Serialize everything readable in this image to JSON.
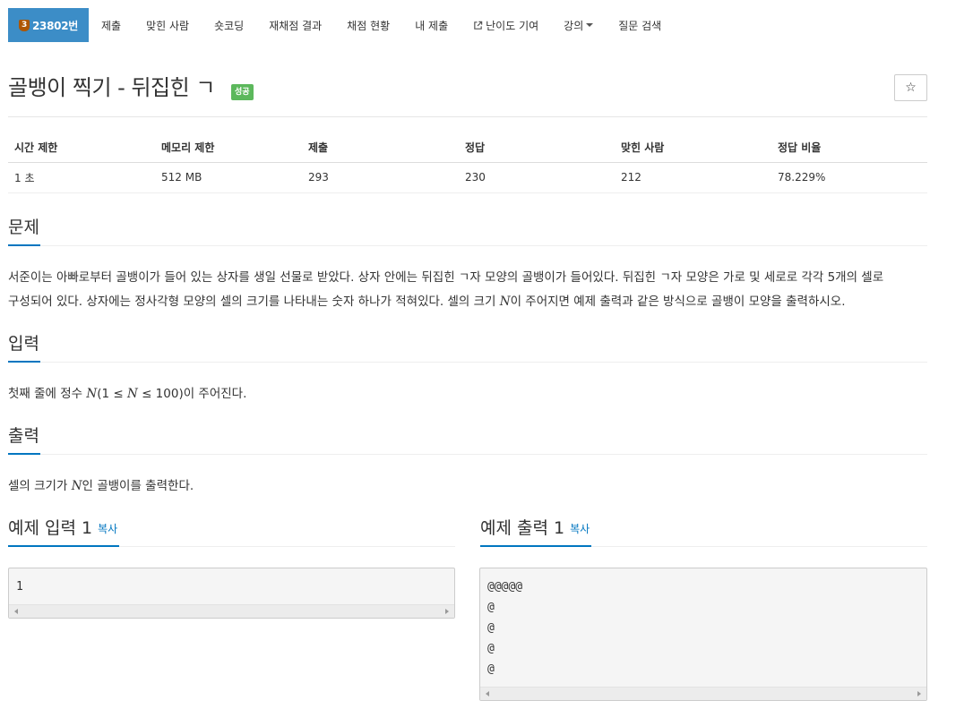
{
  "nav": {
    "problem_tier": "3",
    "problem_id": "23802번",
    "items": [
      "제출",
      "맞힌 사람",
      "숏코딩",
      "재채점 결과",
      "채점 현황",
      "내 제출",
      "난이도 기여",
      "강의",
      "질문 검색"
    ]
  },
  "problem": {
    "title": "골뱅이 찍기 - 뒤집힌 ㄱ",
    "status_badge": "성공",
    "star_icon": "☆"
  },
  "info_table": {
    "headers": [
      "시간 제한",
      "메모리 제한",
      "제출",
      "정답",
      "맞힌 사람",
      "정답 비율"
    ],
    "values": [
      "1 초",
      "512 MB",
      "293",
      "230",
      "212",
      "78.229%"
    ]
  },
  "sections": {
    "description": {
      "title": "문제",
      "line1": "서준이는 아빠로부터 골뱅이가 들어 있는 상자를 생일 선물로 받았다. 상자 안에는 뒤집힌 ㄱ자 모양의 골뱅이가 들어있다. 뒤집힌 ㄱ자 모양은 가로 및 세로로 각각 5개의 셀로",
      "line2_a": "구성되어 있다. 상자에는 정사각형 모양의 셀의 크기를 나타내는 숫자 하나가 적혀있다. 셀의 크기 ",
      "line2_var": "N",
      "line2_b": "이 주어지면 예제 출력과 같은 방식으로 골뱅이 모양을 출력하시오."
    },
    "input": {
      "title": "입력",
      "text_a": "첫째 줄에 정수 ",
      "var1": "N",
      "text_b": "(1 ≤ ",
      "var2": "N",
      "text_c": " ≤ 100)이 주어진다."
    },
    "output": {
      "title": "출력",
      "text_a": "셀의 크기가 ",
      "var": "N",
      "text_b": "인 골뱅이를 출력한다."
    }
  },
  "samples": {
    "input_title": "예제 입력 1",
    "output_title": "예제 출력 1",
    "copy_label": "복사",
    "input_content": "1",
    "output_content": "@@@@@\n@\n@\n@\n@"
  },
  "colors": {
    "nav_active": "#3c8dc7",
    "success": "#5cb85c",
    "link": "#0076c0",
    "tier_bronze": "#ad5600"
  }
}
